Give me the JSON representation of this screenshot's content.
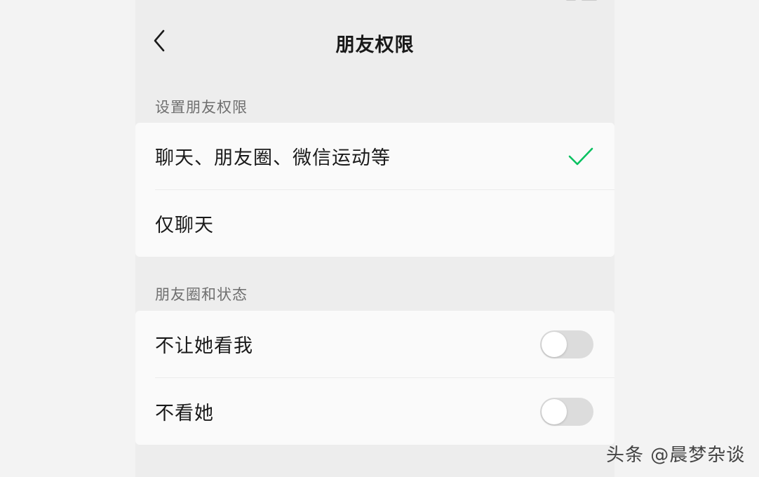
{
  "nav": {
    "title": "朋友权限",
    "back_icon": "chevron-left-icon"
  },
  "sections": [
    {
      "label": "设置朋友权限",
      "items": [
        {
          "label": "聊天、朋友圈、微信运动等",
          "selected": true
        },
        {
          "label": "仅聊天",
          "selected": false
        }
      ]
    },
    {
      "label": "朋友圈和状态",
      "items": [
        {
          "label": "不让她看我",
          "enabled": false
        },
        {
          "label": "不看她",
          "enabled": false
        }
      ]
    }
  ],
  "watermark": "头条 @晨梦杂谈",
  "colors": {
    "accent": "#07c160",
    "background": "#ededed",
    "card": "#fafafa",
    "toggle_off": "#dcdcdc"
  }
}
